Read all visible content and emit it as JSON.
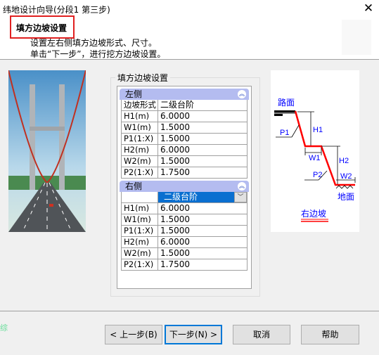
{
  "window": {
    "title": "纬地设计向导(分段1 第三步)",
    "close_icon": "close-icon"
  },
  "header": {
    "title": "填方边坡设置",
    "line1": "设置左右侧填方边坡形式、尺寸。",
    "line2": "单击“下一步”，进行挖方边坡设置。"
  },
  "group": {
    "label": "填方边坡设置"
  },
  "left": {
    "title": "左侧",
    "rows": [
      {
        "k": "边坡形式",
        "v": "二级台阶"
      },
      {
        "k": "H1(m)",
        "v": "6.0000"
      },
      {
        "k": "W1(m)",
        "v": "1.5000"
      },
      {
        "k": "P1(1:X)",
        "v": "1.5000"
      },
      {
        "k": "H2(m)",
        "v": "6.0000"
      },
      {
        "k": "W2(m)",
        "v": "1.5000"
      },
      {
        "k": "P2(1:X)",
        "v": "1.7500"
      }
    ]
  },
  "right": {
    "title": "右侧",
    "form": "二级台阶",
    "rows": [
      {
        "k": "H1(m)",
        "v": "6.0000"
      },
      {
        "k": "W1(m)",
        "v": "1.5000"
      },
      {
        "k": "P1(1:X)",
        "v": "1.5000"
      },
      {
        "k": "H2(m)",
        "v": "6.0000"
      },
      {
        "k": "W2(m)",
        "v": "1.5000"
      },
      {
        "k": "P2(1:X)",
        "v": "1.7500"
      }
    ]
  },
  "diagram": {
    "road": "路面",
    "ground": "地面",
    "caption": "右边坡",
    "H1": "H1",
    "H2": "H2",
    "W1": "W1",
    "W2": "W2",
    "P1": "P1",
    "P2": "P2",
    "slope_color": "#ff0000",
    "label_color": "#0000ff"
  },
  "stray": "综",
  "buttons": {
    "back": "< 上一步(B)",
    "next": "下一步(N) >",
    "cancel": "取消",
    "help": "帮助"
  }
}
